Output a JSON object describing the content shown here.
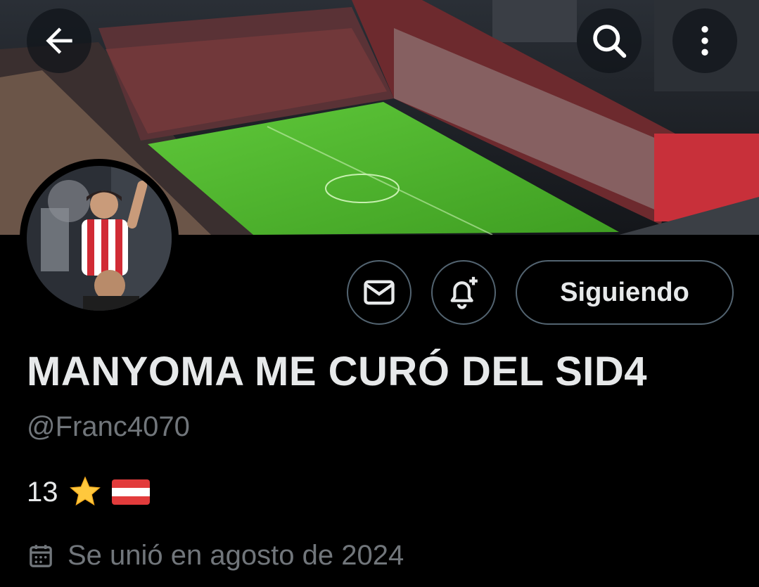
{
  "profile": {
    "display_name": "MANYOMA ME CURÓ DEL SID4",
    "handle": "@Franc4070",
    "bio_text": "13",
    "bio_emojis": [
      "star-emoji",
      "flag-emoji"
    ],
    "joined_text": "Se unió en agosto de 2024"
  },
  "actions": {
    "follow_label": "Siguiendo"
  },
  "icons": {
    "back": "back-arrow-icon",
    "search": "search-icon",
    "more": "more-vertical-icon",
    "message": "envelope-icon",
    "notifications": "bell-plus-icon",
    "calendar": "calendar-icon"
  },
  "colors": {
    "background": "#000000",
    "text_primary": "#e7e9ea",
    "text_secondary": "#71767b",
    "button_border": "#536471"
  }
}
